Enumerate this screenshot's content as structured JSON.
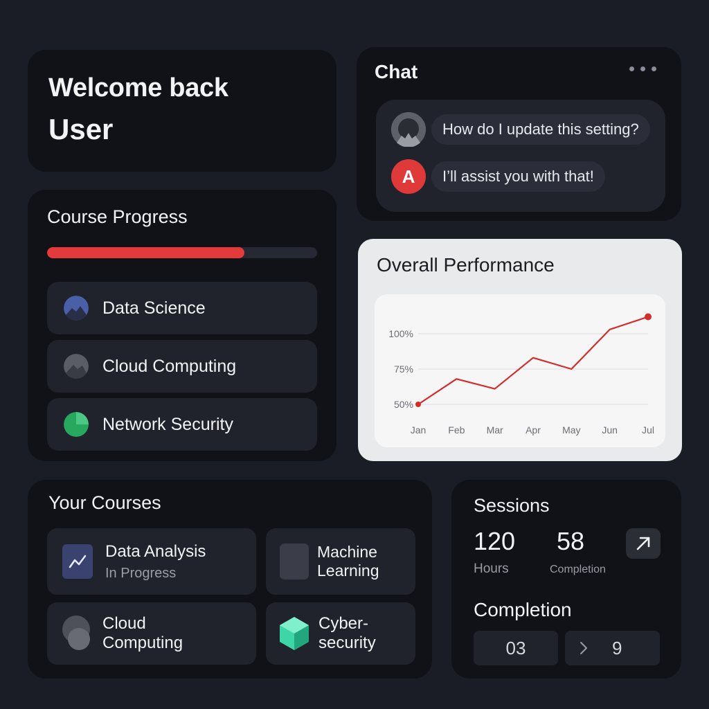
{
  "welcome": {
    "greeting": "Welcome back",
    "user": "User"
  },
  "course_progress": {
    "title": "Course Progress",
    "progress": 0.73,
    "items": [
      {
        "label": "Data Science",
        "icon": "pie-icon",
        "color": "#4a5fa8"
      },
      {
        "label": "Cloud Computing",
        "icon": "pie-icon",
        "color": "#5a5c66"
      },
      {
        "label": "Network Security",
        "icon": "pie-icon",
        "color": "#27a85e"
      }
    ]
  },
  "chat": {
    "title": "Chat",
    "messages": [
      {
        "avatar": "user-avatar",
        "text": "How do I update this setting?"
      },
      {
        "avatar": "assistant-avatar",
        "avatar_letter": "A",
        "text": "I’ll assist you with that!"
      }
    ]
  },
  "performance": {
    "title": "Overall Performance",
    "accent": "#d42b2b"
  },
  "chart_data": {
    "type": "line",
    "title": "Overall Performance",
    "categories": [
      "Jan",
      "Feb",
      "Mar",
      "Apr",
      "May",
      "Jun",
      "Jul"
    ],
    "values": [
      50,
      68,
      61,
      83,
      75,
      103,
      112
    ],
    "y_ticks": [
      "100%",
      "75%",
      "50%"
    ],
    "ylim": [
      50,
      100
    ],
    "grid": true
  },
  "courses": {
    "title": "Your Courses",
    "items": [
      {
        "title": "Data Analysis",
        "subtitle": "In Progress",
        "icon": "chart-line-icon"
      },
      {
        "title_lines": [
          "Machine",
          "Learning"
        ],
        "icon": "square-icon"
      },
      {
        "title_lines": [
          "Cloud",
          "Computing"
        ],
        "icon": "cloud-icon"
      },
      {
        "title_lines": [
          "Cyber-",
          "security"
        ],
        "icon": "cube-icon",
        "color": "#3ed6a6"
      }
    ]
  },
  "sessions": {
    "title": "Sessions",
    "hours_value": "120",
    "hours_label": "Hours",
    "completion_value": "58",
    "completion_label": "Completion",
    "completion_title": "Completion",
    "box_left": "03",
    "box_right": "9"
  }
}
